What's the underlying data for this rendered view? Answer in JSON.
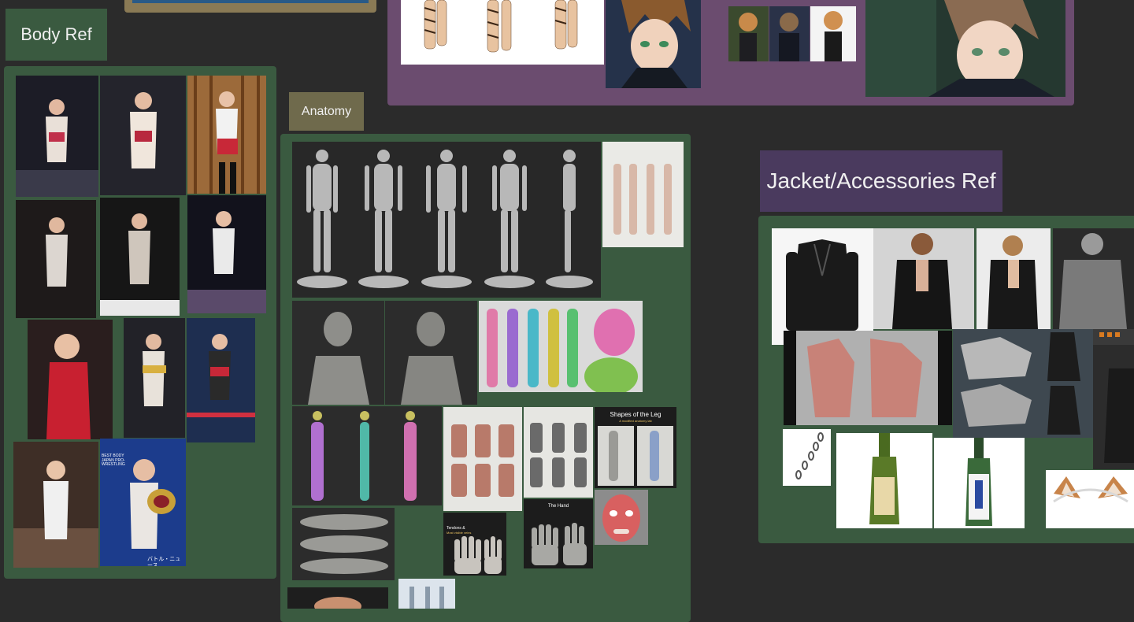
{
  "labels": {
    "body_ref": "Body Ref",
    "anatomy": "Anatomy",
    "jacket_accessories_ref": "Jacket/Accessories Ref"
  },
  "images": {
    "leg_shapes_title": "Shapes of the Leg",
    "leg_shapes_subtitle": "A modified anatomy lab",
    "tendons_title": "Tendons &",
    "tendons_subtitle": "Most visible veins",
    "hand_title": "The Hand",
    "belt_banner_text": "BEST BODY JAPAN PRO-WRESTLING",
    "footer_logo_text": "バトル・ニュース"
  },
  "colors": {
    "canvas": "#2b2b2b",
    "green_group": "#3a5a40",
    "purple_group": "#6b4c6f",
    "tan_group": "#8a7a55",
    "body_label": "#3a5a40",
    "anatomy_label": "#6f6a4c",
    "jacket_label": "#4a3a5e"
  }
}
